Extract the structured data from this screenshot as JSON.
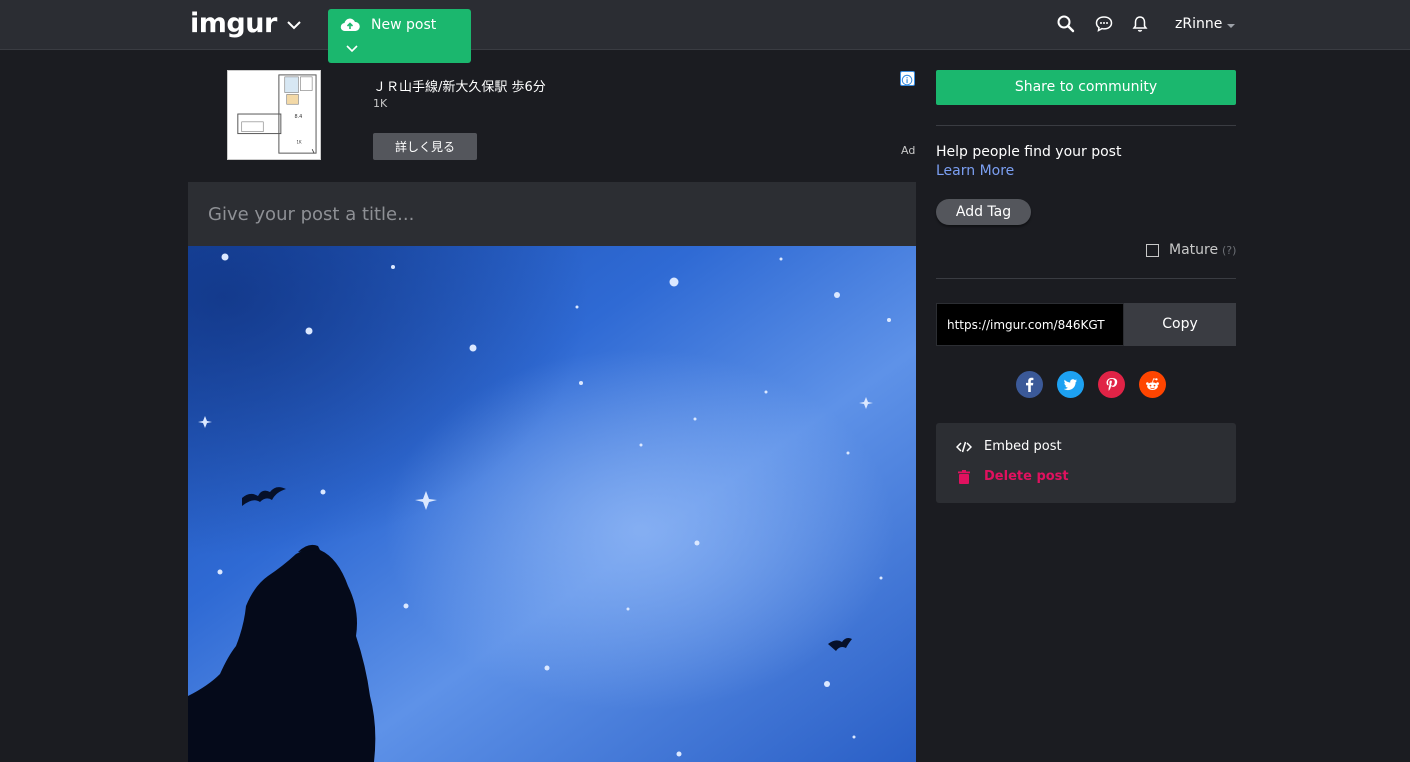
{
  "header": {
    "logo": "imgur",
    "new_post_label": "New post",
    "username": "zRinne",
    "icons": [
      "chevron-down-icon",
      "cloud-upload-icon",
      "search-icon",
      "chat-icon",
      "bell-icon"
    ]
  },
  "ad": {
    "title": "ＪＲ山手線/新大久保駅 歩6分",
    "views": "1K",
    "button_label": "詳しく見る",
    "label": "Ad"
  },
  "post": {
    "title_placeholder": "Give your post a title..."
  },
  "sidebar": {
    "share_label": "Share to community",
    "help_text": "Help people find your post",
    "learn_more": "Learn More",
    "add_tag": "Add Tag",
    "mature_label": "Mature",
    "mature_help": "(?)",
    "mature_checked": false,
    "link_value": "https://imgur.com/846KGT",
    "copy_label": "Copy",
    "social": [
      "facebook-icon",
      "twitter-icon",
      "pinterest-icon",
      "reddit-icon"
    ],
    "embed_label": "Embed post",
    "delete_label": "Delete post"
  },
  "colors": {
    "brand_green": "#1bb76e",
    "background": "#1b1c21",
    "header": "#2b2d33",
    "link_blue": "#7b9ff2",
    "delete_pink": "#e0115f",
    "facebook": "#3b5998",
    "twitter": "#1da1f2",
    "pinterest": "#e02346",
    "reddit": "#ff4500"
  }
}
